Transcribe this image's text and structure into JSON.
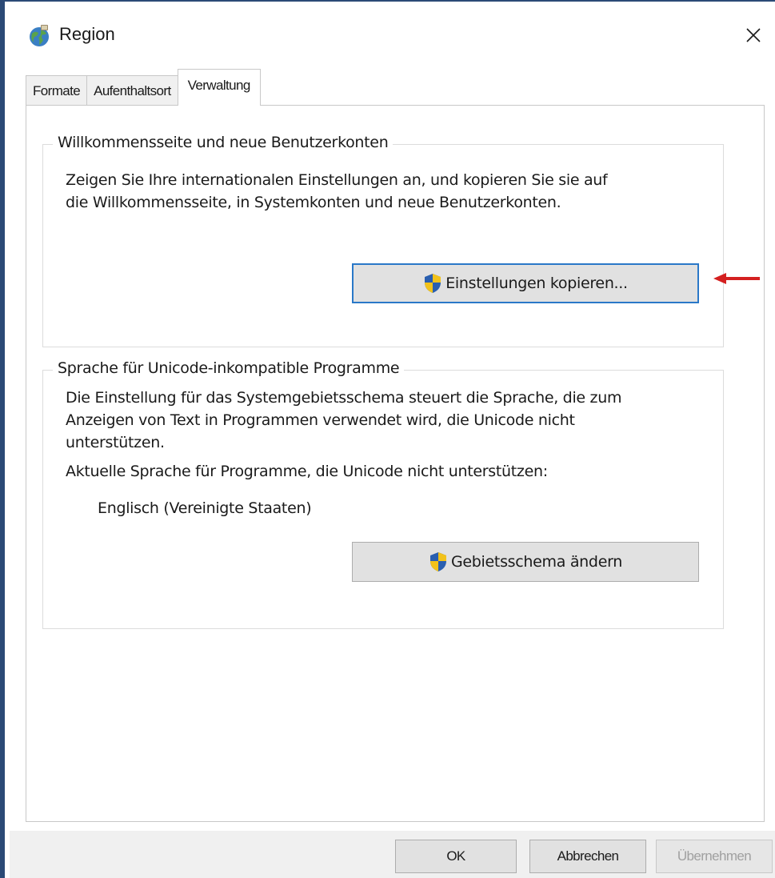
{
  "window": {
    "title": "Region",
    "close_label": "×"
  },
  "tabs": [
    {
      "label": "Formate",
      "active": false
    },
    {
      "label": "Aufenthaltsort",
      "active": false
    },
    {
      "label": "Verwaltung",
      "active": true
    }
  ],
  "welcome_group": {
    "title": "Willkommensseite und neue Benutzerkonten",
    "description_line1": "Zeigen Sie Ihre internationalen Einstellungen an, und kopieren Sie sie auf",
    "description_line2": "die Willkommensseite, in Systemkonten und neue Benutzerkonten.",
    "button_label": "Einstellungen kopieren..."
  },
  "unicode_group": {
    "title": "Sprache für Unicode-inkompatible Programme",
    "description_line1": "Die Einstellung für das Systemgebietsschema steuert die Sprache, die zum",
    "description_line2": "Anzeigen von Text in Programmen verwendet wird, die Unicode nicht",
    "description_line3": "unterstützen.",
    "current_label": "Aktuelle Sprache für Programme, die Unicode nicht unterstützen:",
    "current_value": "Englisch (Vereinigte Staaten)",
    "button_label": "Gebietsschema ändern"
  },
  "footer": {
    "ok_label": "OK",
    "cancel_label": "Abbrechen",
    "apply_label": "Übernehmen"
  },
  "colors": {
    "accent": "#2a78c8",
    "annotation": "#d42020",
    "window_border": "#2b4a76"
  },
  "icons": {
    "title": "globe-icon",
    "buttons": "uac-shield-icon",
    "close": "close-icon",
    "annotation": "red-arrow-icon"
  }
}
